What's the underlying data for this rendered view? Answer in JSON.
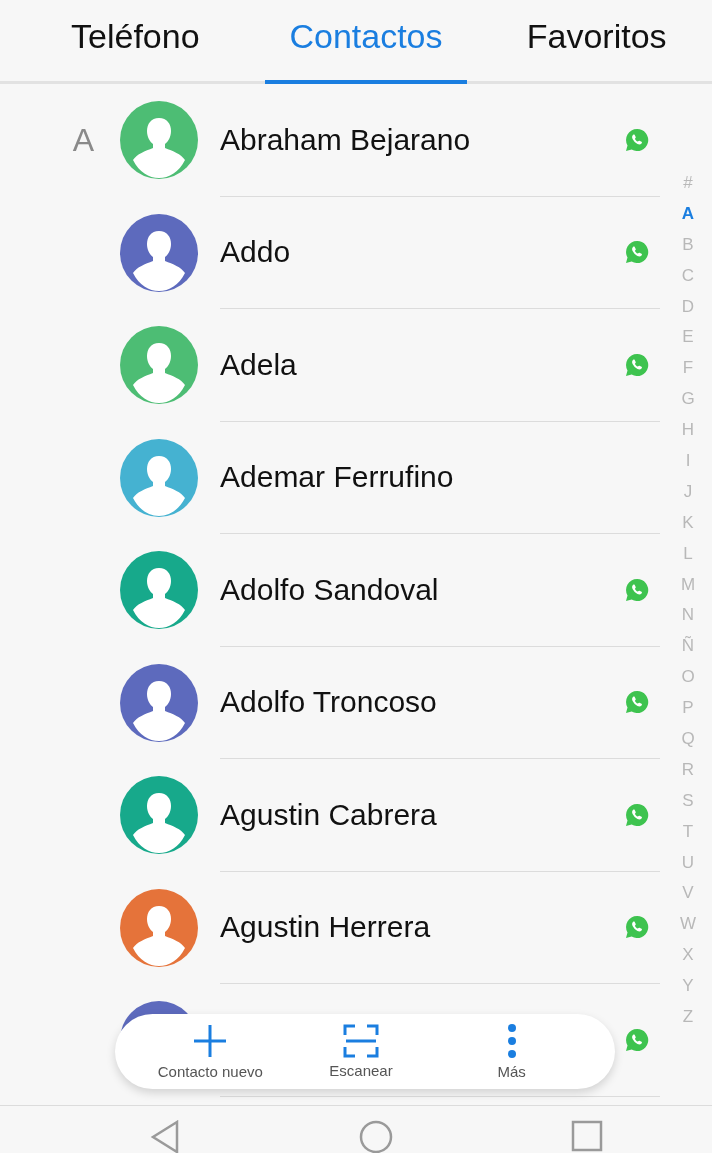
{
  "tabs": [
    {
      "label": "Teléfono",
      "selected": false
    },
    {
      "label": "Contactos",
      "selected": true
    },
    {
      "label": "Favoritos",
      "selected": false
    }
  ],
  "contacts": [
    {
      "section": "A",
      "name": "Abraham Bejarano",
      "color": "#4dbd74",
      "whatsapp": true
    },
    {
      "name": "Addo",
      "color": "#5d6abd",
      "whatsapp": true
    },
    {
      "name": "Adela",
      "color": "#4dbd74",
      "whatsapp": true
    },
    {
      "name": "Ademar Ferrufino",
      "color": "#45b2d1",
      "whatsapp": false
    },
    {
      "name": "Adolfo Sandoval",
      "color": "#17a98b",
      "whatsapp": true
    },
    {
      "name": "Adolfo Troncoso",
      "color": "#5d6abd",
      "whatsapp": true
    },
    {
      "name": "Agustin Cabrera",
      "color": "#17a98b",
      "whatsapp": true
    },
    {
      "name": "Agustin Herrera",
      "color": "#e5733a",
      "whatsapp": true
    },
    {
      "color": "#5d6abd",
      "whatsapp": true
    }
  ],
  "index": [
    {
      "label": "#",
      "selected": false
    },
    {
      "label": "A",
      "selected": true
    },
    {
      "label": "B",
      "selected": false
    },
    {
      "label": "C",
      "selected": false
    },
    {
      "label": "D",
      "selected": false
    },
    {
      "label": "E",
      "selected": false
    },
    {
      "label": "F",
      "selected": false
    },
    {
      "label": "G",
      "selected": false
    },
    {
      "label": "H",
      "selected": false
    },
    {
      "label": "I",
      "selected": false
    },
    {
      "label": "J",
      "selected": false
    },
    {
      "label": "K",
      "selected": false
    },
    {
      "label": "L",
      "selected": false
    },
    {
      "label": "M",
      "selected": false
    },
    {
      "label": "N",
      "selected": false
    },
    {
      "label": "Ñ",
      "selected": false
    },
    {
      "label": "O",
      "selected": false
    },
    {
      "label": "P",
      "selected": false
    },
    {
      "label": "Q",
      "selected": false
    },
    {
      "label": "R",
      "selected": false
    },
    {
      "label": "S",
      "selected": false
    },
    {
      "label": "T",
      "selected": false
    },
    {
      "label": "U",
      "selected": false
    },
    {
      "label": "V",
      "selected": false
    },
    {
      "label": "W",
      "selected": false
    },
    {
      "label": "X",
      "selected": false
    },
    {
      "label": "Y",
      "selected": false
    },
    {
      "label": "Z",
      "selected": false
    }
  ],
  "toolbar": [
    {
      "kind": "add",
      "label": "Contacto nuevo"
    },
    {
      "kind": "scan",
      "label": "Escanear"
    },
    {
      "kind": "more",
      "label": "Más"
    }
  ]
}
